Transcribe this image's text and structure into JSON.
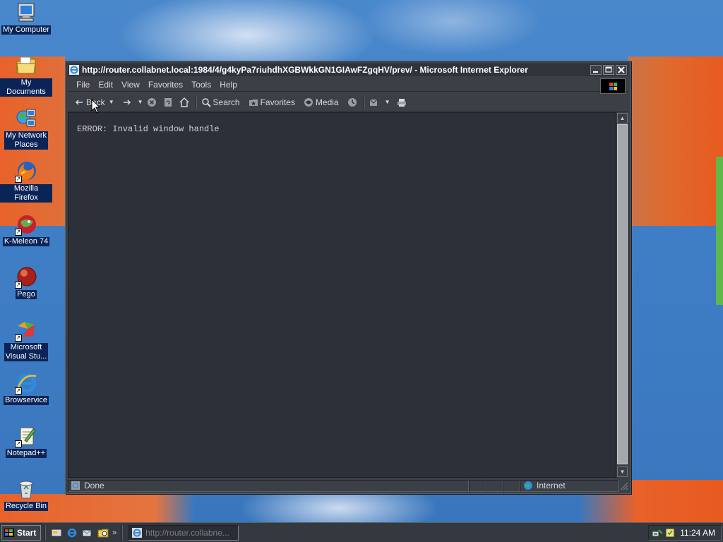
{
  "desktop": {
    "icons": [
      {
        "label": "My Computer",
        "icon": "my-computer-icon"
      },
      {
        "label": "My Documents",
        "icon": "my-documents-icon"
      },
      {
        "label_line1": "My Network",
        "label_line2": "Places",
        "icon": "network-places-icon"
      },
      {
        "label": "Mozilla Firefox",
        "icon": "firefox-icon"
      },
      {
        "label": "K-Meleon 74",
        "icon": "k-meleon-icon"
      },
      {
        "label": "Pego",
        "icon": "pego-icon"
      },
      {
        "label_line1": "Microsoft",
        "label_line2": "Visual Stu...",
        "icon": "visual-studio-icon"
      },
      {
        "label": "Browservice",
        "icon": "internet-explorer-icon"
      },
      {
        "label": "Notepad++",
        "icon": "notepad-plus-plus-icon"
      },
      {
        "label": "Recycle Bin",
        "icon": "recycle-bin-icon"
      }
    ]
  },
  "window": {
    "title": "http://router.collabnet.local:1984/4/g4kyPa7riuhdhXGBWkkGN1GIAwFZgqHV/prev/ - Microsoft Internet Explorer",
    "menu": [
      "File",
      "Edit",
      "View",
      "Favorites",
      "Tools",
      "Help"
    ],
    "toolbar": {
      "back": "Back",
      "search": "Search",
      "favorites": "Favorites",
      "media": "Media"
    },
    "content": {
      "error_text": "ERROR: Invalid window handle"
    },
    "status": {
      "text": "Done",
      "zone": "Internet"
    }
  },
  "taskbar": {
    "start": "Start",
    "task_button": "http://router.collabne...",
    "clock": "11:24 AM"
  },
  "colors": {
    "window_bg": "#3b3f46",
    "content_bg": "#2c3038",
    "desktop_blue": "#3f7fc6",
    "wallpaper_orange": "#e8622a"
  }
}
